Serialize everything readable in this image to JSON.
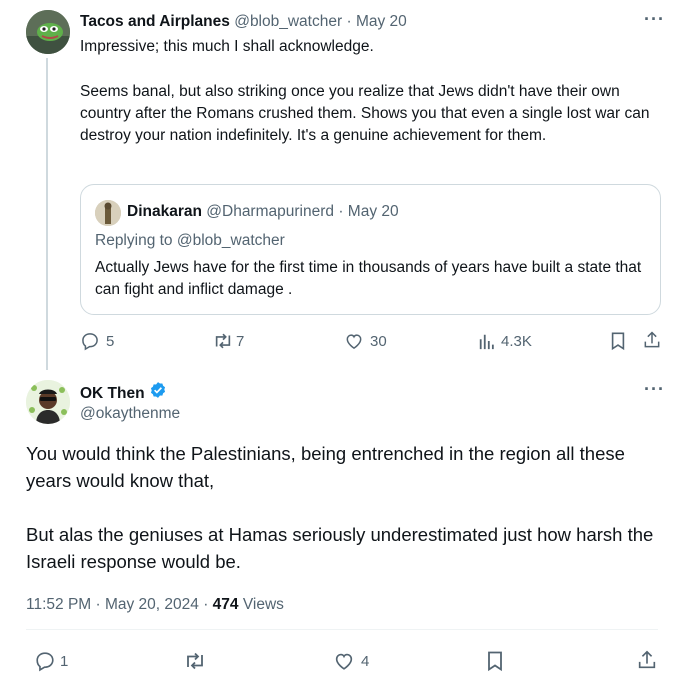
{
  "tweet1": {
    "author_name": "Tacos and Airplanes",
    "author_handle": "@blob_watcher",
    "separator": "·",
    "date": "May 20",
    "line1": "Impressive; this much I shall acknowledge.",
    "para2": "Seems banal, but also striking once you realize that Jews didn't have their own country after the Romans crushed them. Shows you that even a single lost war can destroy your nation indefinitely. It's a genuine achievement for them.",
    "quote": {
      "author_name": "Dinakaran",
      "author_handle": "@Dharmapurinerd",
      "separator": "·",
      "date": "May 20",
      "replying_to": "Replying to @blob_watcher",
      "text": "Actually Jews have for the first time in thousands of years have  built a state that can fight and inflict damage ."
    },
    "actions": {
      "replies": "5",
      "reposts": "7",
      "likes": "30",
      "views": "4.3K"
    }
  },
  "tweet2": {
    "author_name": "OK Then",
    "author_handle": "@okaythenme",
    "verified": true,
    "para1": "You would think the Palestinians, being entrenched in the region all these years would know that,",
    "para2": "But alas the geniuses at Hamas seriously underestimated just how harsh the Israeli response would be.",
    "timestamp": "11:52 PM · May 20, 2024 · ",
    "views_count": "474",
    "views_label": " Views",
    "actions": {
      "replies": "1",
      "likes": "4"
    }
  },
  "colors": {
    "accent": "#1d9bf0",
    "muted": "#536471",
    "border": "#cfd9de",
    "text": "#0f1419"
  },
  "icons": [
    "more-icon",
    "reply-icon",
    "repost-icon",
    "like-icon",
    "views-icon",
    "bookmark-icon",
    "share-icon",
    "verified-icon"
  ]
}
